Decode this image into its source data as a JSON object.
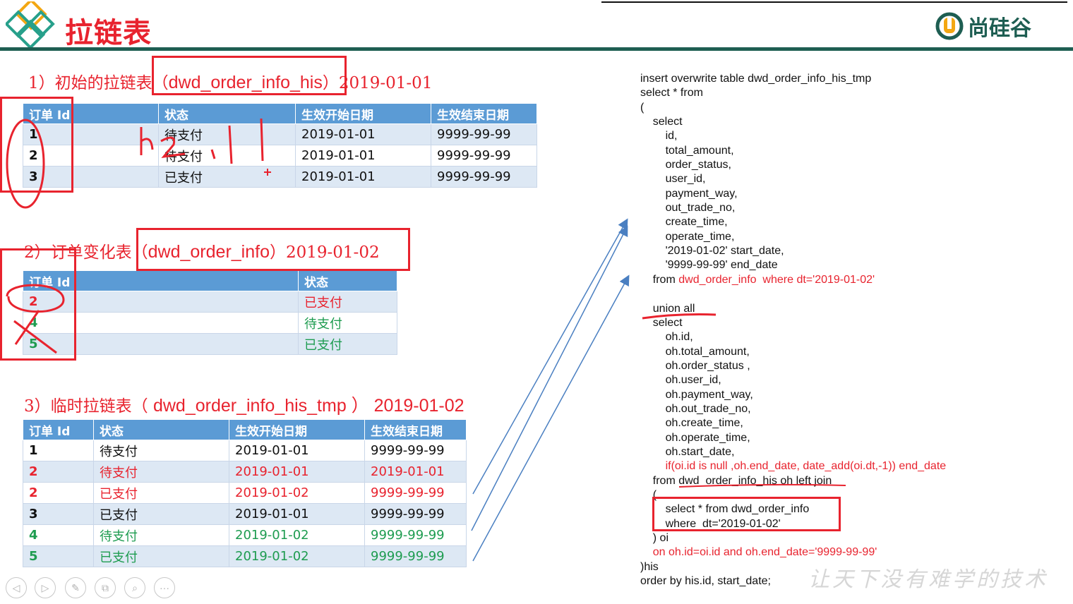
{
  "slide": {
    "title": "拉链表",
    "brand": "尚硅谷",
    "watermark": "让天下没有难学的技术"
  },
  "sections": [
    {
      "prefix": "1）初始的拉链表（",
      "name": "dwd_order_info_his",
      "suffix": "）2019-01-01"
    },
    {
      "prefix": "2）订单变化表（",
      "name": "dwd_order_info",
      "suffix": "）2019-01-02"
    },
    {
      "prefix": "3）临时拉链表（ ",
      "name": "dwd_order_info_his_tmp",
      "suffix": " ） 2019-01-02"
    }
  ],
  "table1": {
    "headers": [
      "订单 Id",
      "状态",
      "生效开始日期",
      "生效结束日期"
    ],
    "rows": [
      [
        "1",
        "待支付",
        "2019-01-01",
        "9999-99-99"
      ],
      [
        "2",
        "待支付",
        "2019-01-01",
        "9999-99-99"
      ],
      [
        "3",
        "已支付",
        "2019-01-01",
        "9999-99-99"
      ]
    ]
  },
  "table2": {
    "headers": [
      "订单 Id",
      "状态"
    ],
    "rows": [
      [
        "2",
        "已支付"
      ],
      [
        "4",
        "待支付"
      ],
      [
        "5",
        "已支付"
      ]
    ]
  },
  "table3": {
    "headers": [
      "订单 Id",
      "状态",
      "生效开始日期",
      "生效结束日期"
    ],
    "rows": [
      [
        "1",
        "待支付",
        "2019-01-01",
        "9999-99-99"
      ],
      [
        "2",
        "待支付",
        "2019-01-01",
        "2019-01-01"
      ],
      [
        "2",
        "已支付",
        "2019-01-02",
        "9999-99-99"
      ],
      [
        "3",
        "已支付",
        "2019-01-01",
        "9999-99-99"
      ],
      [
        "4",
        "待支付",
        "2019-01-02",
        "9999-99-99"
      ],
      [
        "5",
        "已支付",
        "2019-01-02",
        "9999-99-99"
      ]
    ]
  },
  "sql": [
    "insert overwrite table dwd_order_info_his_tmp",
    "select * from",
    "(",
    "    select",
    "        id,",
    "        total_amount,",
    "        order_status,",
    "        user_id,",
    "        payment_way,",
    "        out_trade_no,",
    "        create_time,",
    "        operate_time,",
    "        '2019-01-02' start_date,",
    "        '9999-99-99' end_date",
    "    from ",
    "",
    "    union all",
    "    select",
    "        oh.id,",
    "        oh.total_amount,",
    "        oh.order_status ,",
    "        oh.user_id,",
    "        oh.payment_way,",
    "        oh.out_trade_no,",
    "        oh.create_time,",
    "        oh.operate_time,",
    "        oh.start_date,",
    "        ",
    "    from dwd_order_info_his oh left join",
    "    (",
    "        select * from dwd_order_info",
    "        where  dt='2019-01-02'",
    "    ) oi",
    "    ",
    ")his",
    "order by his.id, start_date;"
  ],
  "sql_red": {
    "from_where": "dwd_order_info  where dt='2019-01-02'",
    "if_line": "if(oi.id is null ,oh.end_date, date_add(oi.dt,-1)) end_date",
    "on_line": "on oh.id=oi.id and oh.end_date='9999-99-99'"
  },
  "handwriting": {
    "note": "h2,1"
  },
  "nav": [
    "◁",
    "▷",
    "✎",
    "⧉",
    "⌕",
    "···"
  ]
}
